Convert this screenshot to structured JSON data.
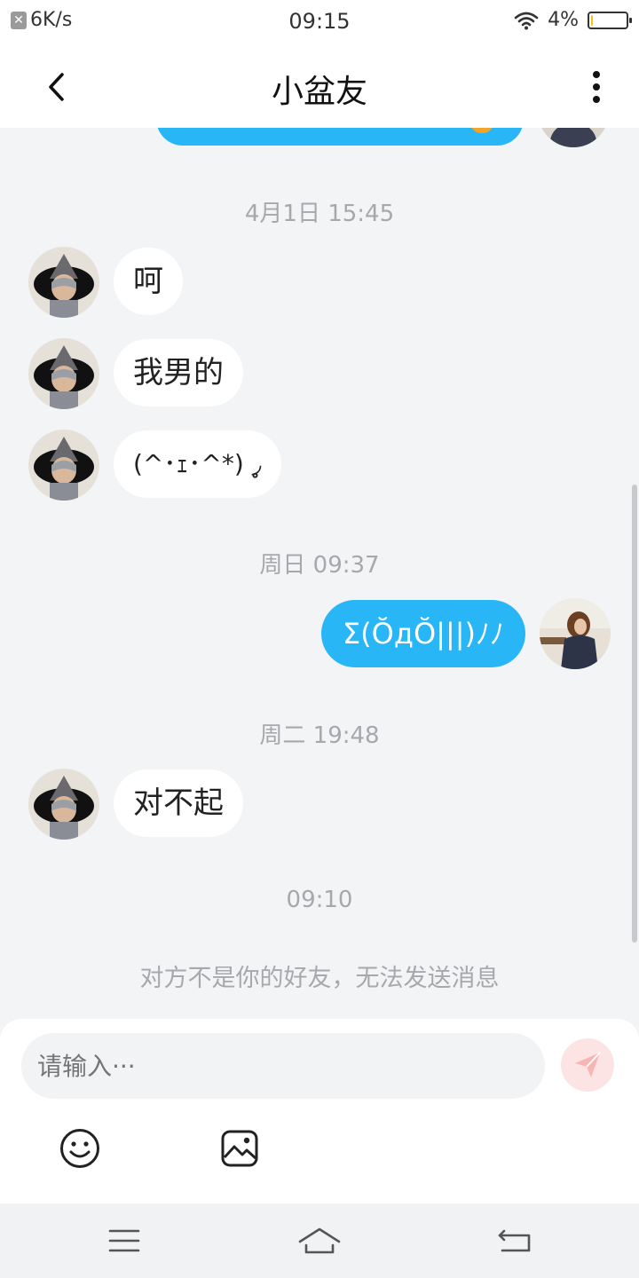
{
  "status_bar": {
    "speed": "6K/s",
    "time": "09:15",
    "battery": "4%",
    "battery_level": 0.04,
    "close_glyph": "✕"
  },
  "nav": {
    "title": "小盆友",
    "back_icon": "chevron-left-icon",
    "more_icon": "more-vertical-icon"
  },
  "chat": {
    "messages": [
      {
        "type": "timestamp",
        "text": "4月1日 15:45"
      },
      {
        "type": "incoming",
        "text": "呵"
      },
      {
        "type": "incoming",
        "text": "我男的"
      },
      {
        "type": "incoming",
        "text": "(^･ｪ･^*) ◞̥̥̥"
      },
      {
        "type": "timestamp",
        "text": "周日 09:37"
      },
      {
        "type": "outgoing",
        "text": "Σ(ŎдŎ|||)ﾉﾉ"
      },
      {
        "type": "timestamp",
        "text": "周二 19:48"
      },
      {
        "type": "incoming",
        "text": "对不起"
      },
      {
        "type": "timestamp",
        "text": "09:10"
      }
    ],
    "notice": "对方不是你的好友，无法发送消息"
  },
  "input": {
    "placeholder": "请输入···"
  },
  "toolbar": {
    "emoji_icon": "smiley-icon",
    "image_icon": "image-icon",
    "send_icon": "send-icon"
  },
  "colors": {
    "accent": "#29b6f6",
    "background": "#f3f4f6",
    "timestamp": "#a6a8ac",
    "send_disabled": "#fde4e4"
  }
}
